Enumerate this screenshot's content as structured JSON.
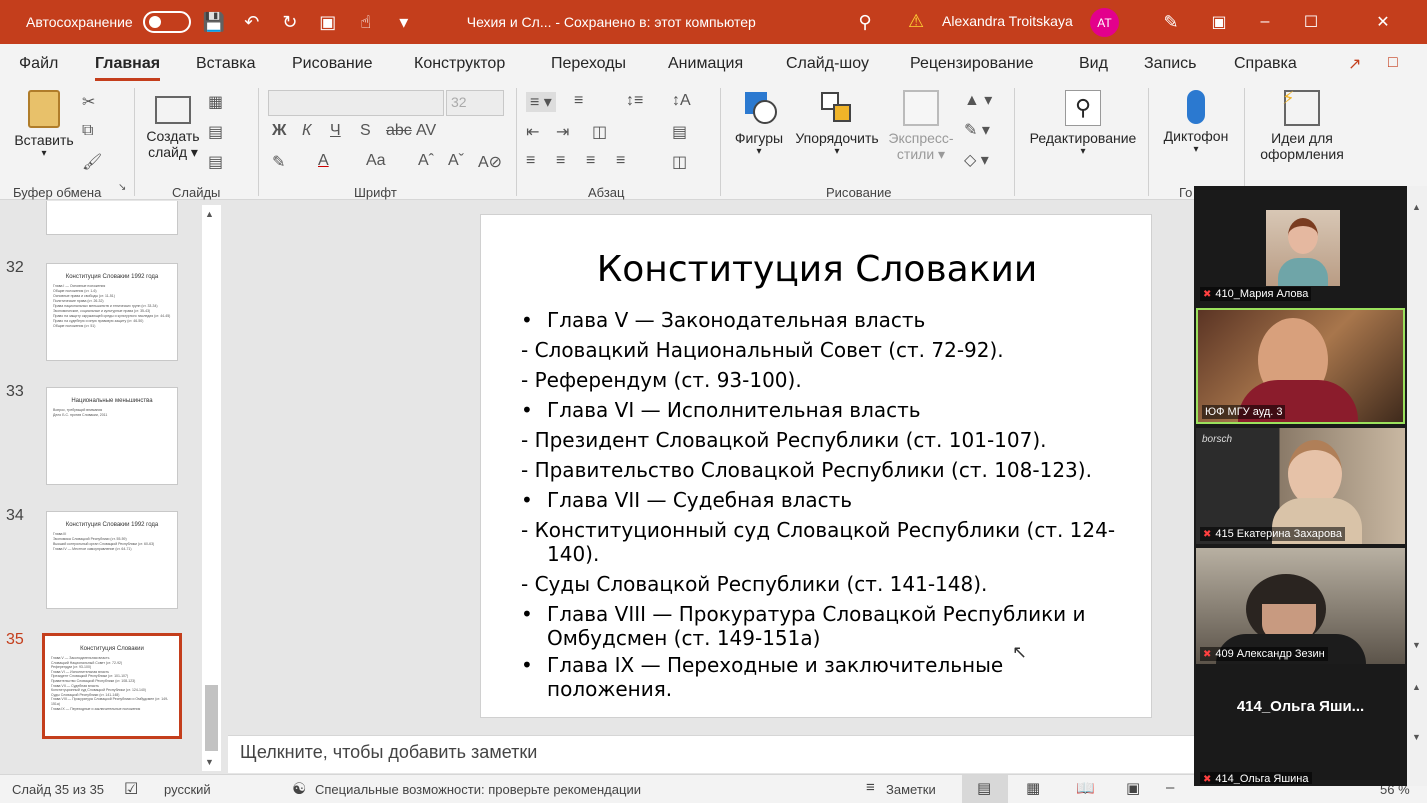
{
  "titlebar": {
    "autosave_label": "Автосохранение",
    "document": "Чехия и Сл...  -  Сохранено в: этот компьютер",
    "user_name": "Alexandra Troitskaya",
    "user_initials": "AT"
  },
  "menu": [
    "Файл",
    "Главная",
    "Вставка",
    "Рисование",
    "Конструктор",
    "Переходы",
    "Анимация",
    "Слайд-шоу",
    "Рецензирование",
    "Вид",
    "Запись",
    "Справка"
  ],
  "ribbon": {
    "paste": "Вставить",
    "create_slide_1": "Создать",
    "create_slide_2": "слайд",
    "font_size": "32",
    "shapes": "Фигуры",
    "arrange": "Упорядочить",
    "express_1": "Экспресс-",
    "express_2": "стили",
    "editing": "Редактирование",
    "dictate": "Диктофон",
    "ideas_1": "Идеи для",
    "ideas_2": "оформления",
    "groups": {
      "clipboard": "Буфер обмена",
      "slides": "Слайды",
      "font": "Шрифт",
      "paragraph": "Абзац",
      "drawing": "Рисование",
      "voice": "Го"
    }
  },
  "thumbnails": [
    {
      "num": "32",
      "title": "Конституция Словакии 1992 года",
      "lines": [
        "Глава I — Основные положения",
        "Общие положения (ст. 1-6)",
        "Основные права и свободы (ст. 11-51)",
        "Политические права (ст. 26-32)",
        "Права национальных меньшинств и этнических групп (ст. 33-34)",
        "Экономические, социальные и культурные права (ст. 35-43)",
        "Право на защиту окружающей среды и культурного наследия (ст. 44-45)",
        "Право на судебную и иную правовую защиту (ст. 46-50)",
        "Общие положения (ст. 51)"
      ]
    },
    {
      "num": "33",
      "title": "Национальные меньшинства",
      "lines": [
        "Вопрос, требующий внимания",
        "Дело Б.С. против Словакии, 2011"
      ]
    },
    {
      "num": "34",
      "title": "Конституция Словакии 1992 года",
      "lines": [
        "Глава III",
        "Экономика Словацкой Республики (ст. 55-59)",
        "Высший контрольный орган Словацкой Республики (ст. 60-63)",
        "Глава IV — Местное самоуправление (ст. 64-71)"
      ]
    },
    {
      "num": "35",
      "title": "Конституция Словакии",
      "lines": [
        "Глава V — Законодательная власть",
        "Словацкий Национальный Совет (ст. 72-92)",
        "Референдум (ст. 93-100)",
        "Глава VI — Исполнительная власть",
        "Президент Словацкой Республики (ст. 101-107)",
        "Правительство Словацкой Республики (ст. 108-123)",
        "Глава VII — Судебная власть",
        "Конституционный суд Словацкой Республики (ст. 124-140)",
        "Суды Словацкой Республики (ст. 141-148)",
        "Глава VIII — Прокуратура Словацкой Республики и Омбудсмен (ст. 149-151а)",
        "Глава IX — Переходные и заключительные положения"
      ]
    }
  ],
  "slide": {
    "title": "Конституция Словакии",
    "lines": [
      {
        "type": "bullet",
        "text": "Глава V — Законодательная власть"
      },
      {
        "type": "dash",
        "text": "- Словацкий Национальный Совет (ст. 72-92)."
      },
      {
        "type": "dash",
        "text": "- Референдум (ст. 93-100)."
      },
      {
        "type": "bullet",
        "text": "Глава VI — Исполнительная власть"
      },
      {
        "type": "dash",
        "text": "- Президент Словацкой Республики (ст. 101-107)."
      },
      {
        "type": "dash",
        "text": "- Правительство Словацкой Республики (ст. 108-123)."
      },
      {
        "type": "bullet",
        "text": "Глава VII — Судебная власть"
      },
      {
        "type": "wrap",
        "text": "- Конституционный суд Словацкой Республики (ст. 124-140)."
      },
      {
        "type": "dash",
        "text": "-   Суды Словацкой Республики (ст. 141-148)."
      },
      {
        "type": "bulletwrap",
        "text": "Глава VIII — Прокуратура Словацкой Республики и Омбудсмен (ст. 149-151а)"
      },
      {
        "type": "bulletwrap",
        "text": "Глава IX — Переходные и заключительные положения."
      }
    ]
  },
  "notes_placeholder": "Щелкните, чтобы добавить заметки",
  "status": {
    "slide_of": "Слайд 35 из 35",
    "language": "русский",
    "accessibility": "Специальные возможности: проверьте рекомендации",
    "notes": "Заметки",
    "zoom": "56 %"
  },
  "participants": [
    {
      "name": "410_Мария Алова",
      "muted": true
    },
    {
      "name": "ЮФ МГУ ауд. 3",
      "muted": false
    },
    {
      "name": "415 Екатерина Захарова",
      "muted": true
    },
    {
      "name": "409 Александр Зезин",
      "muted": true
    },
    {
      "name": "414_Ольга Яшина",
      "display": "414_Ольга  Яши...",
      "muted": true
    }
  ],
  "colors": {
    "accent": "#c43e1c",
    "avatar": "#e3008c"
  }
}
